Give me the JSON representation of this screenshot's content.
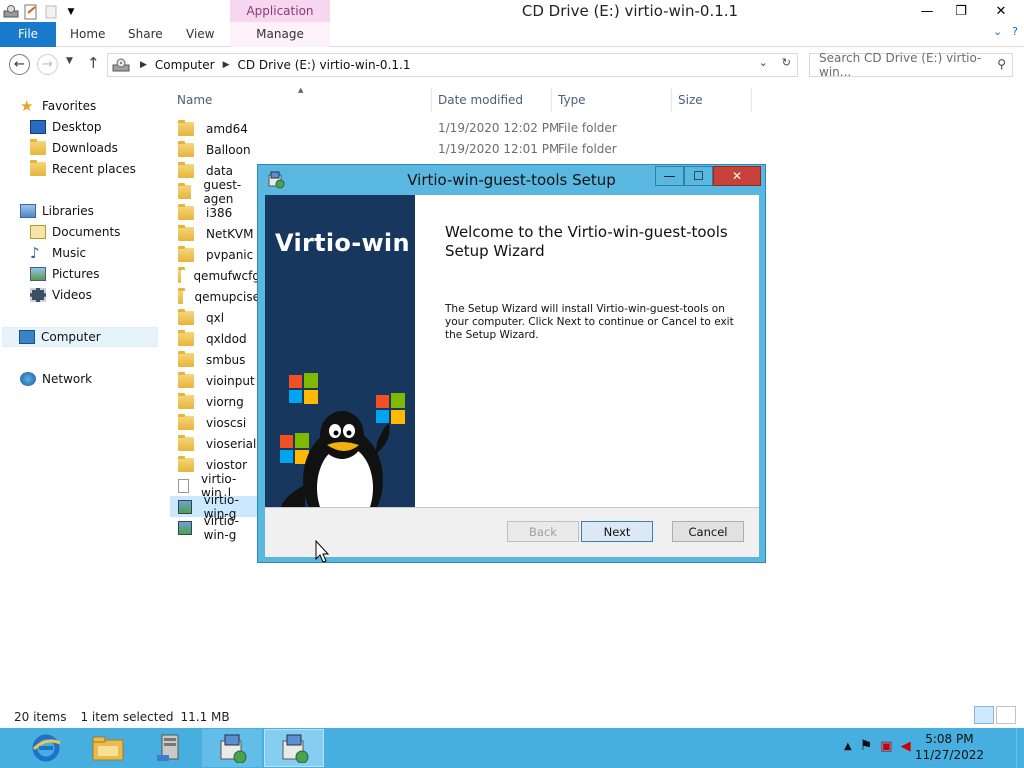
{
  "window": {
    "title": "CD Drive (E:) virtio-win-0.1.1",
    "context_tab": "Application Tools",
    "minimize_glyph": "—",
    "maximize_glyph": "❐",
    "close_glyph": "✕"
  },
  "ribbon": {
    "file": "File",
    "tabs": [
      "Home",
      "Share",
      "View"
    ],
    "manage": "Manage",
    "expand_glyph": "⌄",
    "help_glyph": "?"
  },
  "address": {
    "crumbs": [
      "Computer",
      "CD Drive (E:) virtio-win-0.1.1"
    ],
    "search_placeholder": "Search CD Drive (E:) virtio-win...",
    "dropdown_glyph": "⌄",
    "refresh_glyph": "↻"
  },
  "navpane": {
    "favorites": "Favorites",
    "desktop": "Desktop",
    "downloads": "Downloads",
    "recent": "Recent places",
    "libraries": "Libraries",
    "documents": "Documents",
    "music": "Music",
    "pictures": "Pictures",
    "videos": "Videos",
    "computer": "Computer",
    "network": "Network"
  },
  "columns": {
    "name": "Name",
    "date": "Date modified",
    "type": "Type",
    "size": "Size"
  },
  "files": [
    {
      "name": "amd64",
      "date": "1/19/2020 12:02 PM",
      "type": "File folder",
      "icon": "folder"
    },
    {
      "name": "Balloon",
      "date": "1/19/2020 12:01 PM",
      "type": "File folder",
      "icon": "folder"
    },
    {
      "name": "data",
      "date": "",
      "type": "",
      "icon": "folder"
    },
    {
      "name": "guest-agen",
      "date": "",
      "type": "",
      "icon": "folder"
    },
    {
      "name": "i386",
      "date": "",
      "type": "",
      "icon": "folder"
    },
    {
      "name": "NetKVM",
      "date": "",
      "type": "",
      "icon": "folder"
    },
    {
      "name": "pvpanic",
      "date": "",
      "type": "",
      "icon": "folder"
    },
    {
      "name": "qemufwcfg",
      "date": "",
      "type": "",
      "icon": "folder"
    },
    {
      "name": "qemupcise",
      "date": "",
      "type": "",
      "icon": "folder"
    },
    {
      "name": "qxl",
      "date": "",
      "type": "",
      "icon": "folder"
    },
    {
      "name": "qxldod",
      "date": "",
      "type": "",
      "icon": "folder"
    },
    {
      "name": "smbus",
      "date": "",
      "type": "",
      "icon": "folder"
    },
    {
      "name": "vioinput",
      "date": "",
      "type": "",
      "icon": "folder"
    },
    {
      "name": "viorng",
      "date": "",
      "type": "",
      "icon": "folder"
    },
    {
      "name": "vioscsi",
      "date": "",
      "type": "",
      "icon": "folder"
    },
    {
      "name": "vioserial",
      "date": "",
      "type": "",
      "icon": "folder"
    },
    {
      "name": "viostor",
      "date": "",
      "type": "",
      "icon": "folder"
    },
    {
      "name": "virtio-win_l",
      "date": "",
      "type": "",
      "icon": "document"
    },
    {
      "name": "virtio-win-g",
      "date": "",
      "type": "",
      "icon": "installer",
      "selected": true
    },
    {
      "name": "virtio-win-g",
      "date": "",
      "type": "",
      "icon": "installer"
    }
  ],
  "status": {
    "count": "20 items",
    "selected": "1 item selected",
    "size": "11.1 MB"
  },
  "dialog": {
    "title": "Virtio-win-guest-tools Setup",
    "banner_title": "Virtio-win",
    "welcome": "Welcome to the Virtio-win-guest-tools Setup Wizard",
    "description": "The Setup Wizard will install Virtio-win-guest-tools on your computer. Click Next to continue or Cancel to exit the Setup Wizard.",
    "back": "Back",
    "next": "Next",
    "cancel": "Cancel",
    "back_enabled": false
  },
  "taskbar": {
    "time": "5:08 PM",
    "date": "11/27/2022",
    "tray_glyph": "▲",
    "items": [
      "internet-explorer-icon",
      "file-explorer-icon",
      "server-manager-icon",
      "installer-icon",
      "installer-icon"
    ]
  },
  "colors": {
    "accent": "#1979ca",
    "dialog_frame": "#5ab7e0",
    "banner": "#17375e",
    "taskbar": "#47aee0"
  }
}
